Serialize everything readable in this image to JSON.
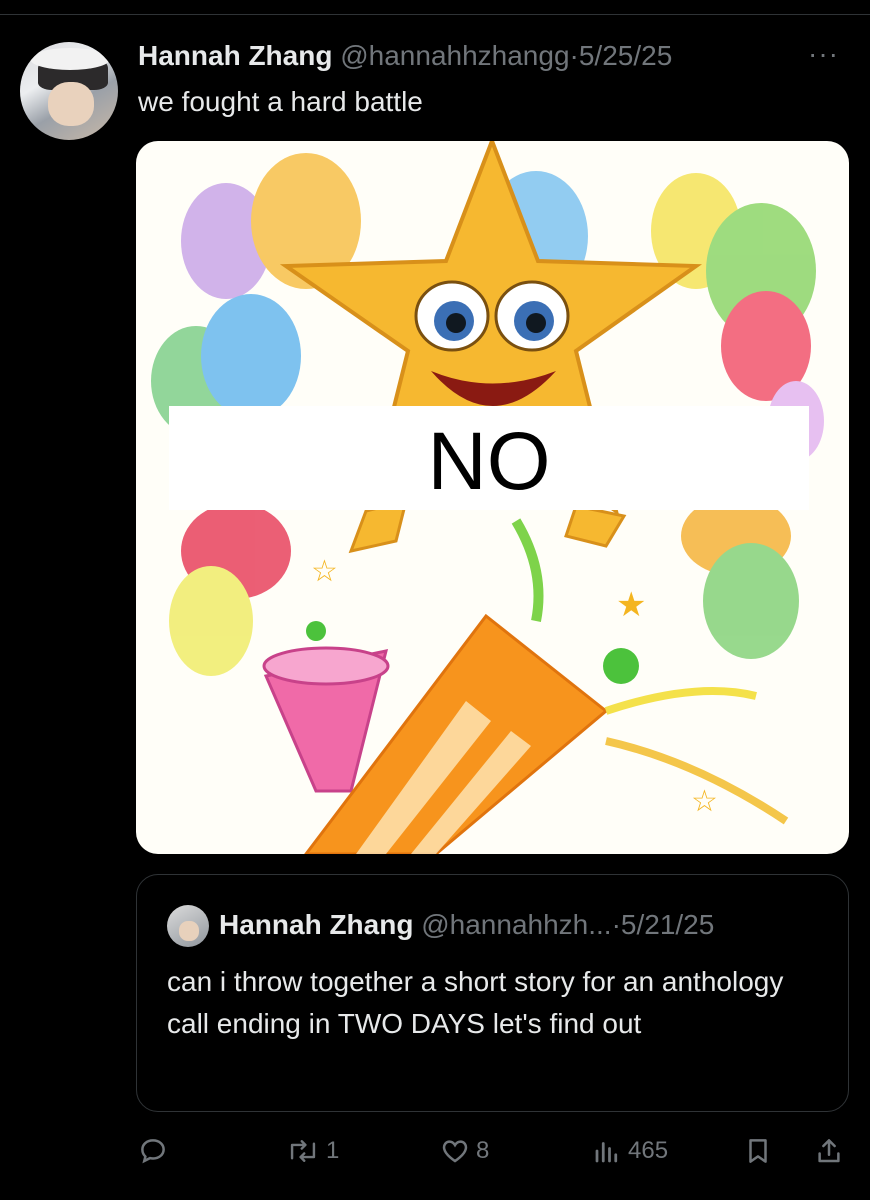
{
  "tweet": {
    "author_name": "Hannah Zhang",
    "handle": "@hannahhzhangg",
    "separator": "·",
    "date": "5/25/25",
    "more_label": "···",
    "text": "we fought a hard battle",
    "media": {
      "overlay_text": "NO",
      "icons": [
        "star-emoji",
        "balloons",
        "party-popper",
        "confetti"
      ]
    }
  },
  "quote": {
    "author_name": "Hannah Zhang",
    "handle": "@hannahhzh...",
    "separator": "·",
    "date": "5/21/25",
    "text": "can i throw together a short story for an anthology call ending in TWO DAYS let's find out"
  },
  "actions": {
    "reply_count": "",
    "retweet_count": "1",
    "like_count": "8",
    "view_count": "465"
  },
  "colors": {
    "background": "#000000",
    "text_primary": "#e7e9ea",
    "text_secondary": "#71767b",
    "border": "#2f3336"
  }
}
